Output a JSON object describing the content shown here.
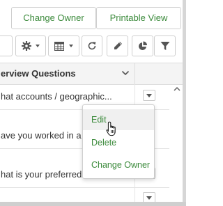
{
  "top_buttons": {
    "change_owner": "Change Owner",
    "printable_view": "Printable View"
  },
  "toolbar": {
    "icons": [
      "gear-icon",
      "grid-columns-icon",
      "refresh-icon",
      "pencil-icon",
      "pie-chart-icon",
      "filter-icon"
    ]
  },
  "grid": {
    "column_header": "erview Questions",
    "rows": [
      "hat accounts / geographic...",
      "ave you worked in a",
      "hat is your preferred",
      ""
    ]
  },
  "row_menu": {
    "items": [
      "Edit",
      "Delete",
      "Change Owner"
    ]
  },
  "colors": {
    "accent_green": "#3b8a3b",
    "text": "#333333",
    "border": "#cfcfcf"
  }
}
